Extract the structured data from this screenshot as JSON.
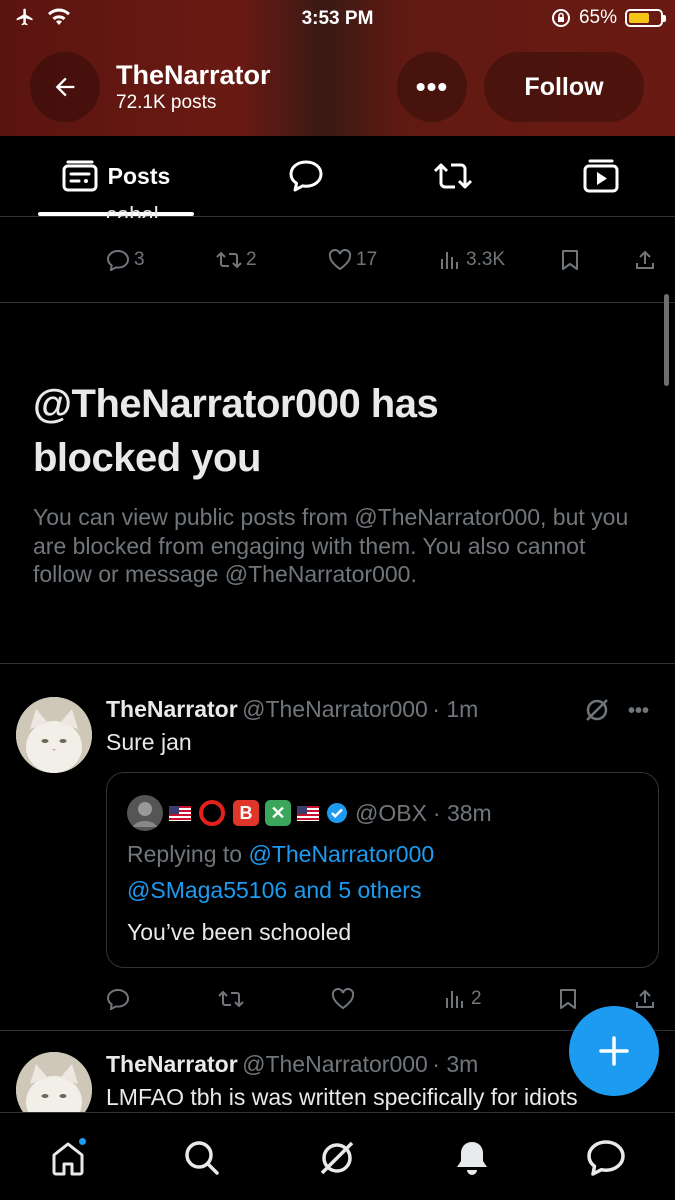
{
  "status_bar": {
    "time": "3:53 PM",
    "battery_percent": "65%",
    "battery_level": 0.65
  },
  "header": {
    "name": "TheNarrator",
    "post_count": "72.1K posts",
    "more_label": "•••",
    "follow_label": "Follow"
  },
  "tabs": {
    "posts_label": "Posts",
    "icons": [
      "posts-icon",
      "replies-icon",
      "reposts-icon",
      "media-icon"
    ]
  },
  "prev_tweet": {
    "cut_text": "cabal.",
    "replies": "3",
    "reposts": "2",
    "likes": "17",
    "views": "3.3K"
  },
  "blocked": {
    "title": "@TheNarrator000 has blocked you",
    "body": "You can view public posts from @TheNarrator000, but you are blocked from engaging with them. You also cannot follow or message @TheNarrator000."
  },
  "tweet1": {
    "name": "TheNarrator",
    "handle": "@TheNarrator000",
    "time": "· 1m",
    "text": "Sure jan",
    "quote": {
      "handle": "@OBX",
      "time": "· 38m",
      "replying_to_prefix": "Replying to ",
      "replying_to_1": "@TheNarrator000",
      "replying_to_2": "@SMaga55106 and 5 others",
      "text": "You’ve been schooled"
    },
    "views": "2"
  },
  "tweet2": {
    "name": "TheNarrator",
    "handle": "@TheNarrator000",
    "time": "· 3m",
    "text": "LMFAO tbh is was written specifically for idiots"
  },
  "nav": {
    "items": [
      "home-icon",
      "search-icon",
      "grok-icon",
      "notifications-icon",
      "messages-icon"
    ]
  },
  "colors": {
    "accent": "#1d9bf0",
    "banner": "#6a1a12",
    "muted": "#71767b"
  }
}
